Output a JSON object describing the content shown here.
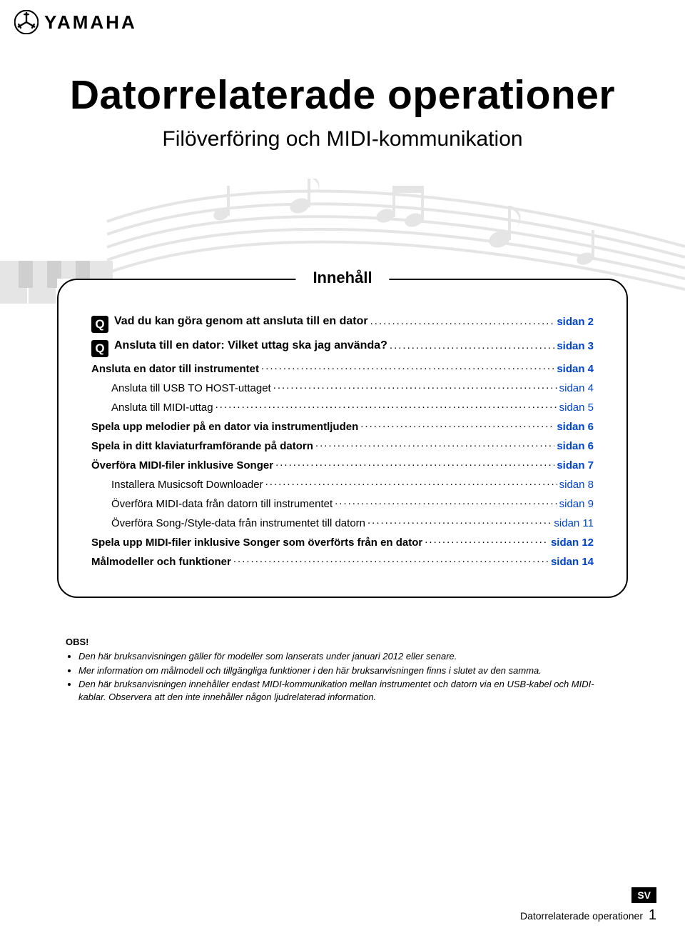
{
  "brand": {
    "name": "YAMAHA"
  },
  "title": "Datorrelaterade operationer",
  "subtitle": "Filöverföring och MIDI-kommunikation",
  "toc": {
    "legend": "Innehåll",
    "q_glyph": "Q",
    "items": [
      {
        "type": "q",
        "label": "Vad du kan göra genom att ansluta till en dator",
        "page": "sidan 2"
      },
      {
        "type": "q",
        "label": "Ansluta till en dator: Vilket uttag ska jag använda?",
        "page": "sidan 3"
      },
      {
        "type": "bold",
        "label": "Ansluta en dator till instrumentet",
        "page": "sidan 4"
      },
      {
        "type": "sub",
        "label": "Ansluta till USB TO HOST-uttaget",
        "page": "sidan 4"
      },
      {
        "type": "sub",
        "label": "Ansluta till MIDI-uttag",
        "page": "sidan 5"
      },
      {
        "type": "bold",
        "label": "Spela upp melodier på en dator via instrumentljuden",
        "page": "sidan 6"
      },
      {
        "type": "bold",
        "label": "Spela in ditt klaviaturframförande på datorn",
        "page": "sidan 6"
      },
      {
        "type": "bold",
        "label": "Överföra MIDI-filer inklusive Songer",
        "page": "sidan 7"
      },
      {
        "type": "sub",
        "label": "Installera Musicsoft Downloader",
        "page": "sidan 8"
      },
      {
        "type": "sub",
        "label": "Överföra MIDI-data från datorn till instrumentet",
        "page": "sidan 9"
      },
      {
        "type": "sub",
        "label": "Överföra Song-/Style-data från instrumentet till datorn",
        "page": "sidan 11"
      },
      {
        "type": "bold",
        "label": "Spela upp MIDI-filer inklusive Songer som överförts från en dator",
        "page": "sidan 12"
      },
      {
        "type": "bold",
        "label": "Målmodeller och funktioner",
        "page": "sidan 14"
      }
    ]
  },
  "obs": {
    "title": "OBS!",
    "notes": [
      "Den här bruksanvisningen gäller för modeller som lanserats under januari 2012 eller senare.",
      "Mer information om målmodell och tillgängliga funktioner i den här bruksanvisningen finns i slutet av den samma.",
      "Den här bruksanvisningen innehåller endast MIDI-kommunikation mellan instrumentet och datorn via en USB-kabel och MIDI-kablar. Observera att den inte innehåller någon ljudrelaterad information."
    ]
  },
  "footer": {
    "lang": "SV",
    "doc": "Datorrelaterade operationer",
    "page": "1"
  }
}
